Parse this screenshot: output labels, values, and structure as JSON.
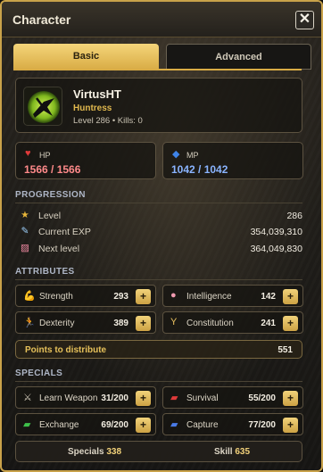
{
  "window": {
    "title": "Character"
  },
  "tabs": [
    {
      "label": "Basic",
      "active": true
    },
    {
      "label": "Advanced",
      "active": false
    }
  ],
  "profile": {
    "name": "VirtusHT",
    "class": "Huntress",
    "level_line": "Level 286 • Kills: 0"
  },
  "hp": {
    "label": "HP",
    "value": "1566 / 1566"
  },
  "mp": {
    "label": "MP",
    "value": "1042 / 1042"
  },
  "progression": {
    "title": "PROGRESSION",
    "rows": [
      {
        "icon": "star-icon",
        "label": "Level",
        "value": "286"
      },
      {
        "icon": "exp-icon",
        "label": "Current EXP",
        "value": "354,039,310"
      },
      {
        "icon": "chart-icon",
        "label": "Next level",
        "value": "364,049,830"
      }
    ]
  },
  "attributes": {
    "title": "ATTRIBUTES",
    "items": [
      {
        "icon": "strength-icon",
        "label": "Strength",
        "value": "293"
      },
      {
        "icon": "intelligence-icon",
        "label": "Intelligence",
        "value": "142"
      },
      {
        "icon": "dexterity-icon",
        "label": "Dexterity",
        "value": "389"
      },
      {
        "icon": "constitution-icon",
        "label": "Constitution",
        "value": "241"
      }
    ],
    "points_label": "Points to distribute",
    "points_value": "551"
  },
  "specials": {
    "title": "SPECIALS",
    "items": [
      {
        "icon": "sword-icon",
        "label": "Learn Weapon",
        "value": "31/200"
      },
      {
        "icon": "survival-icon",
        "label": "Survival",
        "value": "55/200"
      },
      {
        "icon": "exchange-icon",
        "label": "Exchange",
        "value": "69/200"
      },
      {
        "icon": "capture-icon",
        "label": "Capture",
        "value": "77/200"
      }
    ]
  },
  "footer": {
    "specials_label": "Specials",
    "specials_value": "338",
    "skill_label": "Skill",
    "skill_value": "635"
  },
  "colors": {
    "accent": "#d9ac45",
    "hp": "#ff8a8a",
    "mp": "#8ab4ff"
  }
}
